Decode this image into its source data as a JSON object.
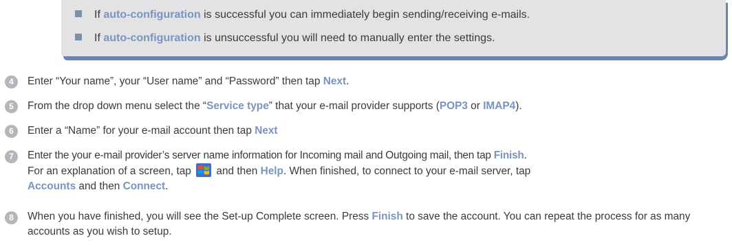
{
  "bullets": [
    {
      "pre": "If ",
      "term": "auto-configuration",
      "post": " is successful you can immediately begin sending/receiving e-mails."
    },
    {
      "pre": "If ",
      "term": "auto-configuration",
      "post": " is unsuccessful you will need to manually enter the settings."
    }
  ],
  "steps": [
    {
      "num": "4",
      "t1": "Enter “Your name”, your “User name” and “Password” then tap ",
      "b1": "Next",
      "t2": "."
    },
    {
      "num": "5",
      "t1": "From the drop down menu select the “",
      "b1": "Service type",
      "t2": "” that your e-mail provider supports (",
      "b2": "POP3",
      "t3": " or ",
      "b3": "IMAP4",
      "t4": ")."
    },
    {
      "num": "6",
      "t1": "Enter a “Name” for your e-mail account then tap ",
      "b1": "Next"
    },
    {
      "num": "7",
      "t1": "Enter the your e-mail provider’s server name information for Incoming mail and Outgoing mail, then tap ",
      "b1": "Finish",
      "t2": ".",
      "t3": "For an explanation of a screen, tap ",
      "t4": " and then ",
      "b2": "Help",
      "t5": ". When finished, to connect to your e-mail server, tap",
      "b3": "Accounts",
      "t6": " and then ",
      "b4": "Connect",
      "t7": "."
    },
    {
      "num": "8",
      "t1": "When you have finished, you will see the Set-up Complete screen.   Press ",
      "b1": "Finish",
      "t2": " to save the account. You can repeat the process for as many accounts as you wish to setup."
    }
  ],
  "icons": {
    "start_menu": "windows-start-icon",
    "bullet": "square-bullet-icon"
  },
  "colors": {
    "highlight": "#7a93bf",
    "note_bg": "#e3e3e5",
    "note_shadow": "#6c84b3",
    "step_circle": "#b5b5bb"
  }
}
